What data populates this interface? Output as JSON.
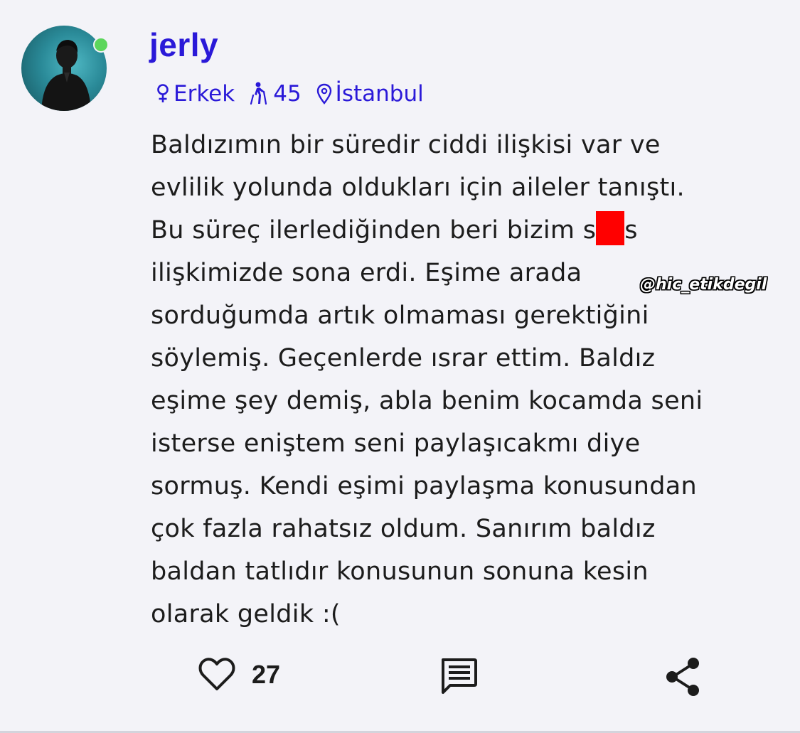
{
  "post": {
    "user": {
      "username": "jerly",
      "avatar": "avatar-man-silhouette",
      "online": true,
      "gender": "Erkek",
      "gender_icon": "female-symbol-icon",
      "age": "45",
      "age_icon": "walking-cane-person-icon",
      "location": "İstanbul",
      "location_icon": "map-pin-icon"
    },
    "body_lines": [
      "Baldızımın bir süredir ciddi ilişkisi var ve",
      "evlilik yolunda oldukları için aileler tanıştı.",
      "Bu süreç ilerlediğinden beri bizim s",
      "ilişkimizde sona erdi. Eşime arada",
      "sorduğumda artık olmaması gerektiğini",
      "söylemiş. Geçenlerde ısrar ettim. Baldız",
      "eşime şey demiş, abla benim kocamda seni",
      "isterse eniştem seni paylaşıcakmı diye",
      "sormuş. Kendi eşimi paylaşma konusundan",
      "çok fazla rahatsız oldum. Sanırım baldız",
      "baldan tatlıdır konusunun sonuna kesin",
      "olarak geldik :("
    ],
    "line3_tail": "s",
    "watermark": "@hic_etikdegil",
    "actions": {
      "like_icon": "heart-outline-icon",
      "like_count": "27",
      "comment_icon": "comment-icon",
      "share_icon": "share-icon"
    }
  },
  "colors": {
    "background": "#f3f3f8",
    "accent": "#2a19d8",
    "text": "#1c1c1c",
    "online": "#5cd65c",
    "redaction": "#ff0000"
  }
}
